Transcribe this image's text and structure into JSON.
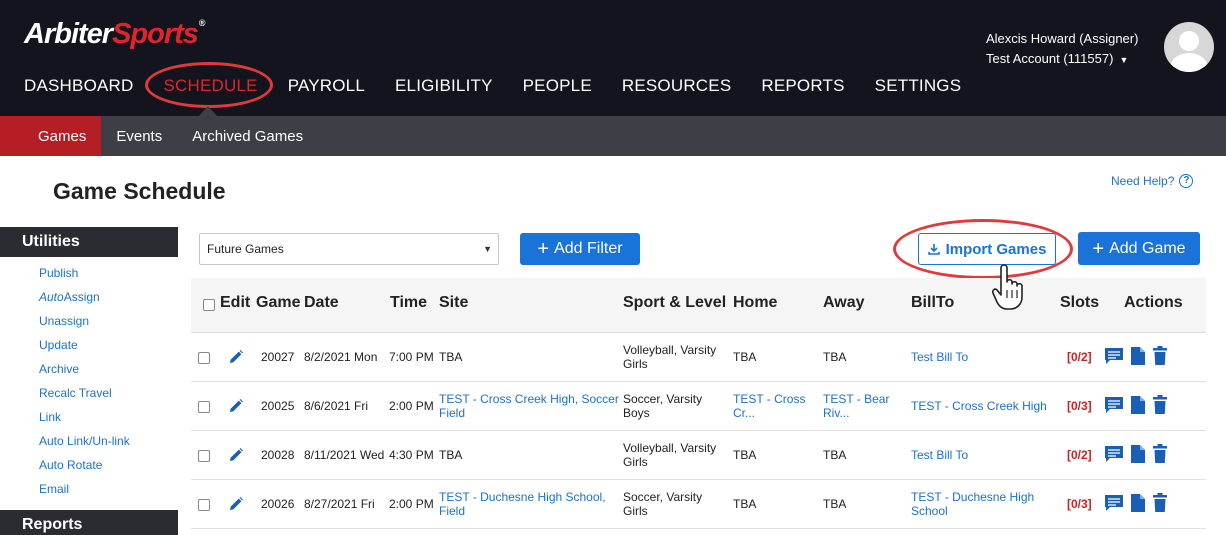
{
  "brand": {
    "part1": "Arbiter",
    "part2": "Sports",
    "tm": "®"
  },
  "user": {
    "name": "Alexcis Howard (Assigner)",
    "account": "Test Account (111557)"
  },
  "main_nav": [
    "DASHBOARD",
    "SCHEDULE",
    "PAYROLL",
    "ELIGIBILITY",
    "PEOPLE",
    "RESOURCES",
    "REPORTS",
    "SETTINGS"
  ],
  "active_main": "SCHEDULE",
  "sub_nav": [
    "Games",
    "Events",
    "Archived Games"
  ],
  "page_title": "Game Schedule",
  "help_label": "Need Help?",
  "sidebar": {
    "utilities_title": "Utilities",
    "links": [
      "Publish",
      "AutoAssign",
      "Unassign",
      "Update",
      "Archive",
      "Recalc Travel",
      "Link",
      "Auto Link/Un-link",
      "Auto Rotate",
      "Email"
    ],
    "reports_title": "Reports"
  },
  "filter": {
    "selected": "Future Games"
  },
  "buttons": {
    "add_filter": "Add Filter",
    "import_games": "Import Games",
    "add_game": "Add Game"
  },
  "table": {
    "headers": {
      "edit": "Edit",
      "game": "Game",
      "date": "Date",
      "time": "Time",
      "site": "Site",
      "sport": "Sport & Level",
      "home": "Home",
      "away": "Away",
      "billto": "BillTo",
      "slots": "Slots",
      "actions": "Actions"
    },
    "rows": [
      {
        "game": "20027",
        "date": "8/2/2021 Mon",
        "time": "7:00 PM",
        "site": "TBA",
        "site_link": false,
        "sport1": "Volleyball, Varsity",
        "sport2": "Girls",
        "home1": "TBA",
        "home2": "",
        "home_link": false,
        "away1": "TBA",
        "away2": "",
        "away_link": false,
        "bill1": "Test Bill To",
        "bill2": "",
        "slots": "[0/2]"
      },
      {
        "game": "20025",
        "date": "8/6/2021 Fri",
        "time": "2:00 PM",
        "site": "TEST - Cross Creek High, Soccer",
        "site2": "Field",
        "site_link": true,
        "sport1": "Soccer, Varsity",
        "sport2": "Boys",
        "home1": "TEST - Cross",
        "home2": "Cr...",
        "home_link": true,
        "away1": "TEST - Bear",
        "away2": "Riv...",
        "away_link": true,
        "bill1": "TEST - Cross Creek High",
        "bill2": "",
        "slots": "[0/3]"
      },
      {
        "game": "20028",
        "date": "8/11/2021 Wed",
        "time": "4:30 PM",
        "site": "TBA",
        "site_link": false,
        "sport1": "Volleyball, Varsity",
        "sport2": "Girls",
        "home1": "TBA",
        "home2": "",
        "home_link": false,
        "away1": "TBA",
        "away2": "",
        "away_link": false,
        "bill1": "Test Bill To",
        "bill2": "",
        "slots": "[0/2]"
      },
      {
        "game": "20026",
        "date": "8/27/2021 Fri",
        "time": "2:00 PM",
        "site": "TEST - Duchesne High School,",
        "site2": "Field",
        "site_link": true,
        "sport1": "Soccer, Varsity",
        "sport2": "Girls",
        "home1": "TBA",
        "home2": "",
        "home_link": false,
        "away1": "TBA",
        "away2": "",
        "away_link": false,
        "bill1": "TEST - Duchesne High",
        "bill2": "School",
        "slots": "[0/3]"
      }
    ]
  },
  "colors": {
    "header_bg": "#14141e",
    "subnav_bg": "#3e3f46",
    "active_red": "#e0242c",
    "link_blue": "#1a73c9",
    "button_blue": "#1a73d9",
    "slot_red": "#d21f1f"
  }
}
